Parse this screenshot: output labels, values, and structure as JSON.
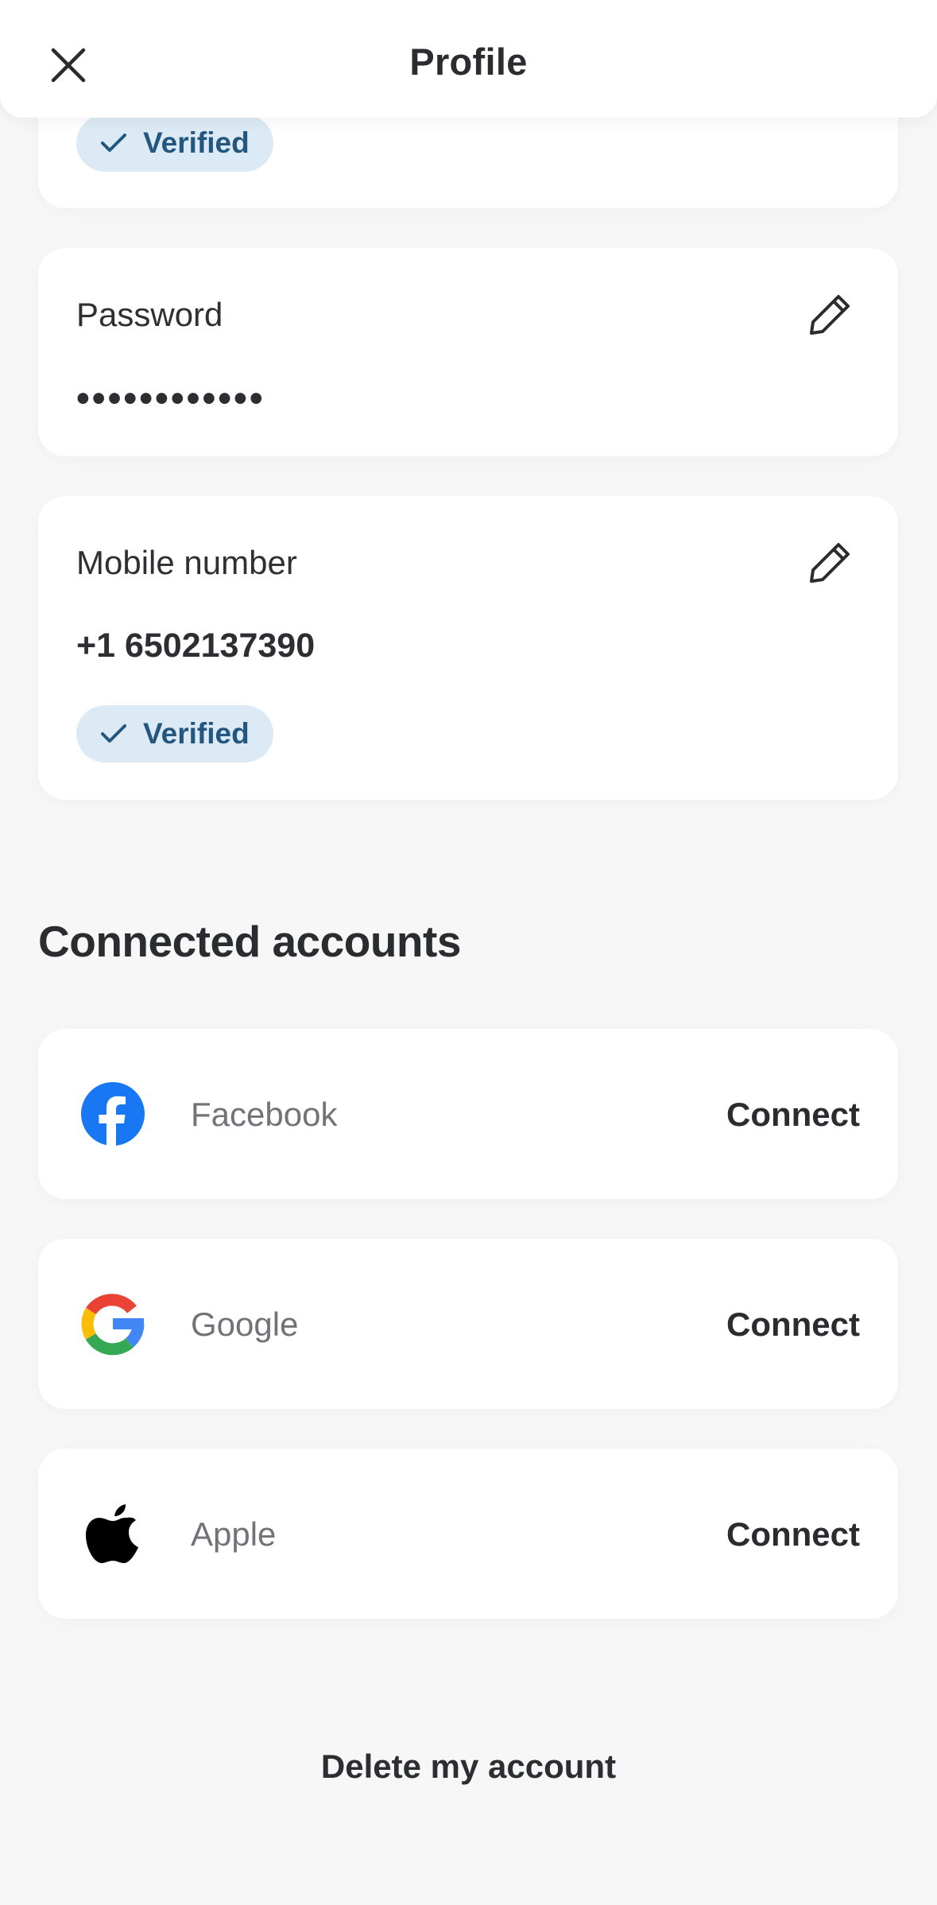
{
  "header": {
    "title": "Profile",
    "close_icon": "close-icon"
  },
  "email_card": {
    "badge": "Verified"
  },
  "password_card": {
    "label": "Password",
    "value": "••••••••••••",
    "edit_icon": "pencil-icon"
  },
  "mobile_card": {
    "label": "Mobile number",
    "value": "+1 6502137390",
    "badge": "Verified",
    "edit_icon": "pencil-icon"
  },
  "connected": {
    "title": "Connected accounts",
    "accounts": [
      {
        "name": "Facebook",
        "action": "Connect",
        "icon": "facebook-icon",
        "color": "#1877f2"
      },
      {
        "name": "Google",
        "action": "Connect",
        "icon": "google-icon"
      },
      {
        "name": "Apple",
        "action": "Connect",
        "icon": "apple-icon",
        "color": "#000000"
      }
    ]
  },
  "footer": {
    "delete_label": "Delete my account"
  },
  "colors": {
    "badge_bg": "#dceaf5",
    "badge_text": "#23577f",
    "background": "#f7f7f8"
  }
}
